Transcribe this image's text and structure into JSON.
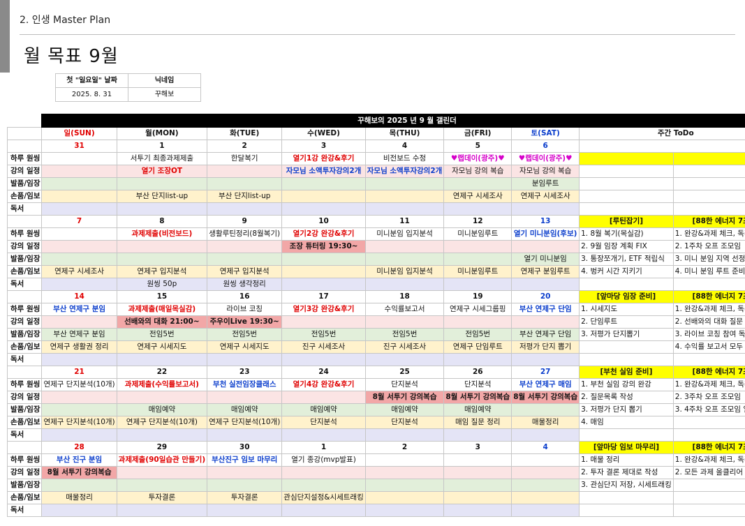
{
  "header": {
    "section_title": "2. 인생 Master Plan",
    "page_title": "월 목표 9월"
  },
  "info": {
    "first_sunday_label": "첫 \"일요일\" 날짜",
    "nickname_label": "닉네임",
    "first_sunday_value": "2025. 8. 31",
    "nickname_value": "꾸해보"
  },
  "calendar": {
    "title": "꾸해보의 2025 년 9 월 갤린더",
    "todo_header": "주간 ToDo",
    "days": [
      "일(SUN)",
      "월(MON)",
      "화(TUE)",
      "수(WED)",
      "목(THU)",
      "금(FRI)",
      "토(SAT)"
    ],
    "row_labels": [
      "하루 원씽",
      "강의 일정",
      "발품/임장",
      "손품/임보",
      "독서"
    ],
    "weeks": [
      {
        "dates": [
          "31",
          "1",
          "2",
          "3",
          "4",
          "5",
          "6"
        ],
        "goal": [
          "",
          "서투기 최종과제제출",
          "한달복기",
          "열기1강 완강&후기",
          "비전보드 수정",
          "♥랩데이(광주)♥",
          "♥랩데이(광주)♥"
        ],
        "lecture": [
          "",
          "열기 조장OT",
          "",
          "자모님 소액투자강의2개",
          "자모님 소액투자강의2개",
          "자모님 강의 복습",
          "자모님 강의 복습"
        ],
        "move": [
          "",
          "",
          "",
          "",
          "",
          "",
          "분임루트"
        ],
        "field": [
          "",
          "부산 단지list-up",
          "부산 단지list-up",
          "",
          "",
          "연제구 시세조사",
          "연제구 시세조사"
        ],
        "read": [
          "",
          "",
          "",
          "",
          "",
          "",
          ""
        ],
        "todo": {
          "left_head": "",
          "right_head": "",
          "left": [],
          "right": []
        }
      },
      {
        "dates": [
          "7",
          "8",
          "9",
          "10",
          "11",
          "12",
          "13"
        ],
        "goal": [
          "",
          "과제제출(비전보드)",
          "생활루틴정리(8월복기)",
          "열기2강 완강&후기",
          "미니분임 입지분석",
          "미니분임루트",
          "열기 미니분임(후보)"
        ],
        "lecture": [
          "",
          "",
          "",
          "조장 튜터링 19:30~",
          "",
          "",
          ""
        ],
        "move": [
          "",
          "",
          "",
          "",
          "",
          "",
          "열기 미니분임"
        ],
        "field": [
          "연제구 시세조사",
          "연제구 입지분석",
          "연제구 입지분석",
          "",
          "미니분임 입지분석",
          "미니분임루트",
          "연제구 분임루트"
        ],
        "read": [
          "",
          "원씽 50p",
          "원씽 생각정리",
          "",
          "",
          "",
          ""
        ],
        "todo": {
          "left_head": "[루틴잡기]",
          "right_head": "[88한 에너지 7조]",
          "left": [
            "1. 8월 복기(목실감)",
            "2. 9월 임장 계획 FIX",
            "3. 통장쪼개기, ETF 적립식",
            "4. 벙커 시간 지키기"
          ],
          "right": [
            "1. 완강&과제 체크, 독려",
            "2. 1주차 오프 조모임",
            "3. 미니 분임 지역 선정",
            "4. 미니 분임 루트 준비"
          ]
        }
      },
      {
        "dates": [
          "14",
          "15",
          "16",
          "17",
          "18",
          "19",
          "20"
        ],
        "goal": [
          "부산 연제구 분임",
          "과제제출(매일목실감)",
          "라이브 코칭",
          "열기3강 완강&후기",
          "수익률보고서",
          "연제구 시세그룹핑",
          "부산 연제구 단임"
        ],
        "lecture": [
          "",
          "선배와의 대화 21:00~",
          "주우이Live 19:30~",
          "",
          "",
          "",
          ""
        ],
        "move": [
          "부산 연제구 분임",
          "전임5번",
          "전임5번",
          "전임5번",
          "전임5번",
          "전임5번",
          "부산 연제구 단임"
        ],
        "field": [
          "연제구 생활권 정리",
          "연제구 시세지도",
          "연제구 시세지도",
          "진구 시세조사",
          "진구 시세조사",
          "연제구 단임루트",
          "저평가 단지 뽑기"
        ],
        "read": [
          "",
          "",
          "",
          "",
          "",
          "",
          ""
        ],
        "todo": {
          "left_head": "[앞마당 임장 준비]",
          "right_head": "[88한 에너지 7조]",
          "left": [
            "1. 시세지도",
            "2. 단임루트",
            "3. 저평가 단지뽑기",
            ""
          ],
          "right": [
            "1. 완강&과제 체크, 독려",
            "2. 선배와의 대화 질문 준비",
            "3. 라이브 코칭 참여 독려",
            "4. 수익률 보고서 모두 제출"
          ]
        }
      },
      {
        "dates": [
          "21",
          "22",
          "23",
          "24",
          "25",
          "26",
          "27"
        ],
        "goal": [
          "연제구 단지분석(10개)",
          "과제제출(수익률보고서)",
          "부천 실전임장클래스",
          "열기4강 완강&후기",
          "단지분석",
          "단지분석",
          "부산 연제구 매임"
        ],
        "lecture": [
          "",
          "",
          "",
          "",
          "8월 서투기 강의복습",
          "8월 서투기 강의복습",
          "8월 서투기 강의복습"
        ],
        "move": [
          "",
          "매임예약",
          "매임예약",
          "매임예약",
          "매임예약",
          "매임예약",
          ""
        ],
        "field": [
          "연제구 단지분석(10개)",
          "연제구 단지분석(10개)",
          "연제구 단지분석(10개)",
          "단지분석",
          "단지분석",
          "매임 질문 정리",
          "매물정리"
        ],
        "read": [
          "",
          "",
          "",
          "",
          "",
          "",
          ""
        ],
        "todo": {
          "left_head": "[부천 실임 준비]",
          "right_head": "[88한 에너지 7조]",
          "left": [
            "1. 부천 실임 강의 완강",
            "2. 질문목록 작성",
            "3. 저평가 단지 뽑기",
            "4. 매임"
          ],
          "right": [
            "1. 완강&과제 체크, 독려",
            "2. 3주차 오프 조모임",
            "3. 4주차 오프 조모임 일정 FIX",
            ""
          ]
        }
      },
      {
        "dates": [
          "28",
          "29",
          "30",
          "1",
          "2",
          "3",
          "4"
        ],
        "goal": [
          "부산 진구 분임",
          "과제제출(90일습관 만들기)",
          "부산진구 임보 마무리",
          "열기 종강(mvp발표)",
          "",
          "",
          ""
        ],
        "lecture": [
          "8월 서투기 강의복습",
          "",
          "",
          "",
          "",
          "",
          ""
        ],
        "move": [
          "",
          "",
          "",
          "",
          "",
          "",
          ""
        ],
        "field": [
          "매물정리",
          "투자결론",
          "투자결론",
          "관심단지설정&시세트래킹",
          "",
          "",
          ""
        ],
        "read": [
          "",
          "",
          "",
          "",
          "",
          "",
          ""
        ],
        "todo": {
          "left_head": "[앞마당 임보 마무리]",
          "right_head": "[88한 에너지 7조]",
          "left": [
            "1. 매물 정리",
            "2. 투자 결론 제대로 작성",
            "3. 관심단지 저장, 시세트래킹",
            ""
          ],
          "right": [
            "1. 완강&과제 체크, 독려",
            "2. 모든 과제 올클리어",
            "",
            ""
          ]
        }
      }
    ]
  }
}
